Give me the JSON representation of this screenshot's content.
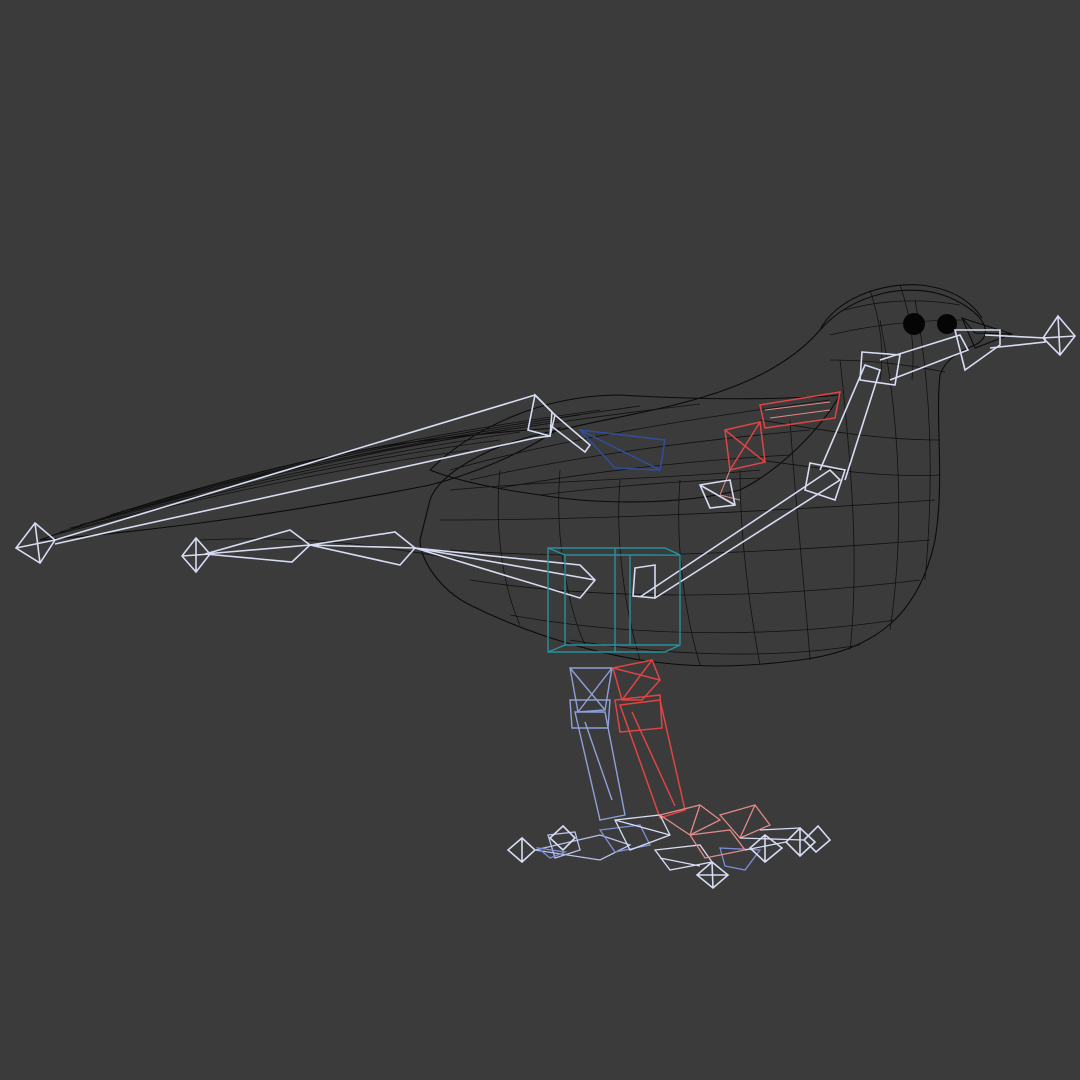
{
  "viewport": {
    "background_color": "#3b3b3b",
    "shading_mode": "wireframe"
  },
  "model": {
    "subject": "bird",
    "mesh_color": "#0b0b0b",
    "colors": {
      "bone_default": "#d6dcf2",
      "bone_right_side": "#e04444",
      "bone_left_side": "#8fa0d8",
      "bone_wing_left": "#334c96",
      "pelvis_helper": "#2b8f9a"
    },
    "icons": {
      "bone": "octahedron-bone-icon",
      "end_effector": "diamond-icon",
      "helper": "box-helper-icon"
    }
  }
}
